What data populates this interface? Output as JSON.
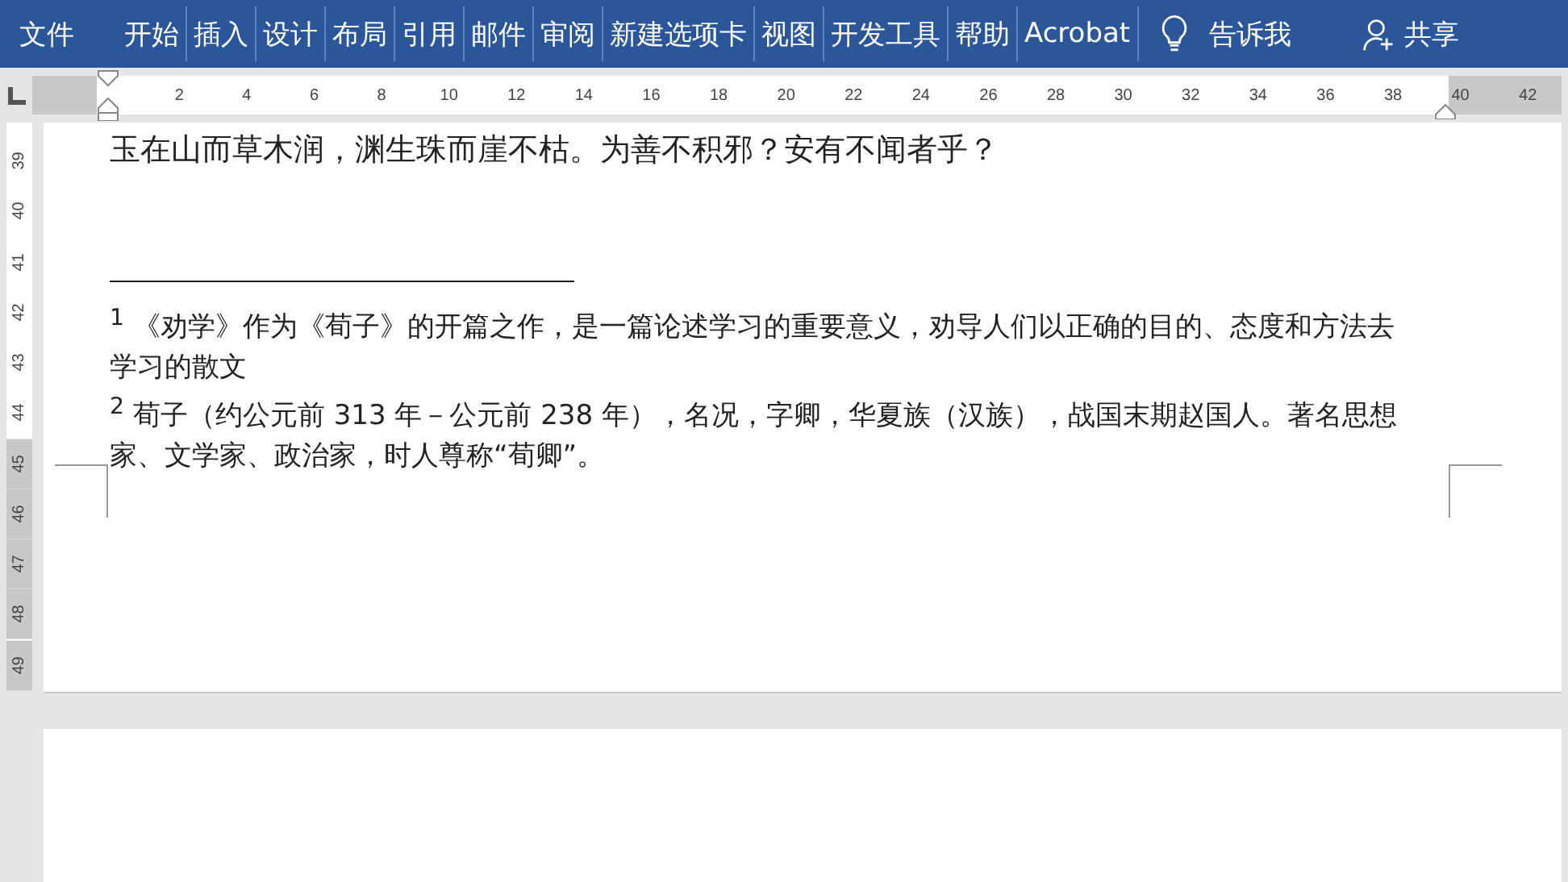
{
  "ribbon": {
    "file_tab": "文件",
    "tabs": [
      {
        "label": "开始",
        "selected": false
      },
      {
        "label": "插入",
        "selected": false
      },
      {
        "label": "设计",
        "selected": false
      },
      {
        "label": "布局",
        "selected": false
      },
      {
        "label": "引用",
        "selected": false
      },
      {
        "label": "邮件",
        "selected": false
      },
      {
        "label": "审阅",
        "selected": false
      },
      {
        "label": "新建选项卡",
        "selected": false
      },
      {
        "label": "视图",
        "selected": false
      },
      {
        "label": "开发工具",
        "selected": false
      },
      {
        "label": "帮助",
        "selected": false
      },
      {
        "label": "Acrobat",
        "selected": false
      }
    ],
    "tell_me": "告诉我",
    "share": "共享"
  },
  "ruler": {
    "labels": [
      "2",
      "4",
      "6",
      "8",
      "10",
      "12",
      "14",
      "16",
      "18",
      "20",
      "22",
      "24",
      "26",
      "28",
      "30",
      "32",
      "34",
      "36",
      "38",
      "40",
      "42"
    ]
  },
  "vertical_ruler": {
    "labels": [
      "39",
      "40",
      "41",
      "42",
      "43",
      "44",
      "45",
      "46",
      "47",
      "48",
      "49"
    ]
  },
  "document": {
    "body_line": "玉在山而草木润，渊生珠而崖不枯。为善不积邪？安有不闻者乎？",
    "footnotes": [
      "$^{1}$ 《劝学》作为《荀子》的开篇之作，是一篇论述学习的重要意义，劝导人们以正确的目的、态度和方法去学习的散文",
      "$^{2}$ 荀子（约公元前 313 年－公元前 238 年），名况，字卿，华夏族（汉族），战国末期赵国人。著名思想家、文学家、政治家，时人尊称“荀卿”。"
    ]
  }
}
